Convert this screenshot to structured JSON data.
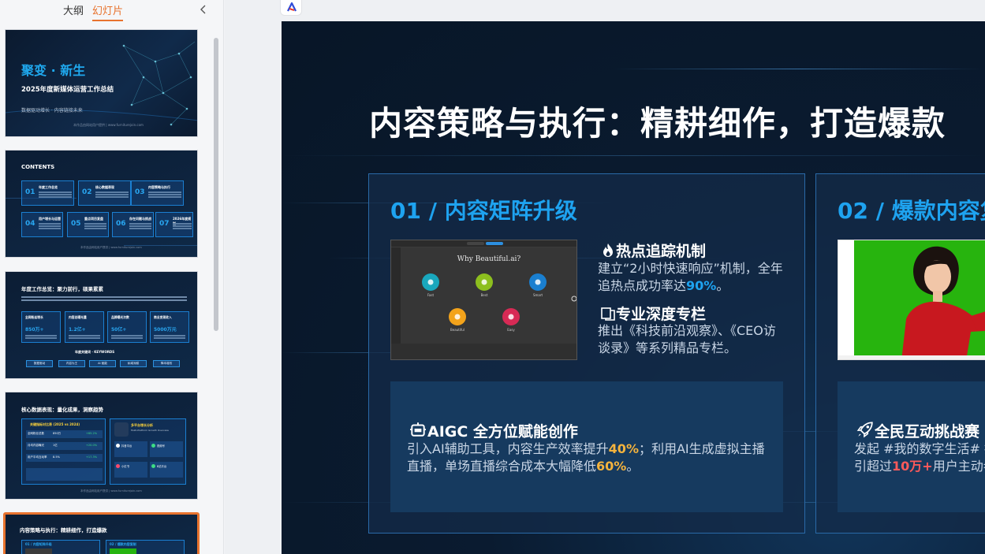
{
  "panel_tabs": {
    "outline": "大纲",
    "slides": "幻灯片"
  },
  "thumbnails": {
    "s1": {
      "title": "聚变 · 新生",
      "subtitle": "2025年度新媒体运营工作总结",
      "tagline": "数据驱动增长 · 内容链接未来",
      "footer": "本作品由网站用户提供 | www.furniturejoin.com"
    },
    "s2": {
      "title": "CONTENTS",
      "items": [
        {
          "num": "01",
          "label": "年度工作总览"
        },
        {
          "num": "02",
          "label": "核心数据表现"
        },
        {
          "num": "03",
          "label": "内容策略与执行"
        },
        {
          "num": "04",
          "label": "用户增长与运营"
        },
        {
          "num": "05",
          "label": "重点项目复盘"
        },
        {
          "num": "06",
          "label": "存在问题与挑战"
        },
        {
          "num": "07",
          "label": "2026年度规划"
        }
      ],
      "footer": "本作品由网站用户提供 | www.furniturejoin.com"
    },
    "s3": {
      "title": "年度工作总览：聚力前行，硕果累累",
      "cards": [
        {
          "label": "全网粉丝增长",
          "value": "850万+"
        },
        {
          "label": "内容总曝光量",
          "value": "1.2亿+"
        },
        {
          "label": "品牌曝光次数",
          "value": "50亿+"
        },
        {
          "label": "商业变现收入",
          "value": "5000万元"
        }
      ],
      "keywords_title": "年度关键词 · KEYWORDS",
      "pills": [
        "数据驱动",
        "内容为王",
        "AI 赋能",
        "私域深耕",
        "降本增效"
      ],
      "footer": "本作品由网站用户提供 | www.furniturejoin.com"
    },
    "s4": {
      "title": "核心数据表现：量化成果，洞察趋势",
      "table_title": "关键指标对比表 (2025 vs 2024)",
      "rows": [
        {
          "label": "全网粉丝总数",
          "a": "850万",
          "b": "+65.2%"
        },
        {
          "label": "月均内容曝光",
          "a": "1亿",
          "b": "+20.0%"
        },
        {
          "label": "用户平均互动率",
          "a": "8.5%",
          "b": "+17.3%"
        }
      ],
      "panel_title": "多平台增长分析",
      "panel_sub": "Multi-Platform Growth Overview",
      "platforms": [
        "抖音平台",
        "视频号",
        "小红书",
        "B站平台"
      ],
      "footer": "本作品由网站用户提供 | www.furniturejoin.com"
    },
    "s5": {
      "title": "内容策略与执行：精耕细作，打造爆款",
      "left": "01 / 内容矩阵升级",
      "right": "02 / 爆款内容复制"
    }
  },
  "slide": {
    "title": "内容策略与执行：精耕细作，打造爆款",
    "panel_a": {
      "heading": "01 / 内容矩阵升级",
      "screenshot": {
        "heading": "Why Beautiful.ai?",
        "icons": [
          {
            "label": "Fast",
            "color": "#19a7bd"
          },
          {
            "label": "Best",
            "color": "#8dbf1e"
          },
          {
            "label": "Smart",
            "color": "#1a7fd0"
          },
          {
            "label": "Beautiful",
            "color": "#f3a31b"
          },
          {
            "label": "Easy",
            "color": "#d72a55"
          }
        ]
      },
      "feature1": {
        "title": "热点追踪机制",
        "text_pre": "建立“2小时快速响应”机制，全年追热点成功率达",
        "highlight": "90%",
        "text_post": "。"
      },
      "feature2": {
        "title": "专业深度专栏",
        "text": "推出《科技前沿观察》、《CEO访谈录》等系列精品专栏。"
      },
      "feature3": {
        "title": "AIGC 全方位赋能创作",
        "t1": "引入AI辅助工具，内容生产效率提升",
        "h1": "40%",
        "t2": "；利用AI生成虚拟主播直播，单场直播综合成本大幅降低",
        "h2": "60%",
        "t3": "。"
      }
    },
    "panel_b": {
      "heading": "02 / 爆款内容复",
      "feature3": {
        "title": "全民互动挑战赛",
        "line1": "发起 #我的数字生活# 挑",
        "t2": "引超过",
        "h": "10万+",
        "t3": "用户主动参"
      }
    }
  },
  "colors": {
    "accent_orange": "#e8732e",
    "slide_blue": "#1ea3f0",
    "highlight_orange": "#f4b33d",
    "highlight_red": "#ff5a5a"
  }
}
